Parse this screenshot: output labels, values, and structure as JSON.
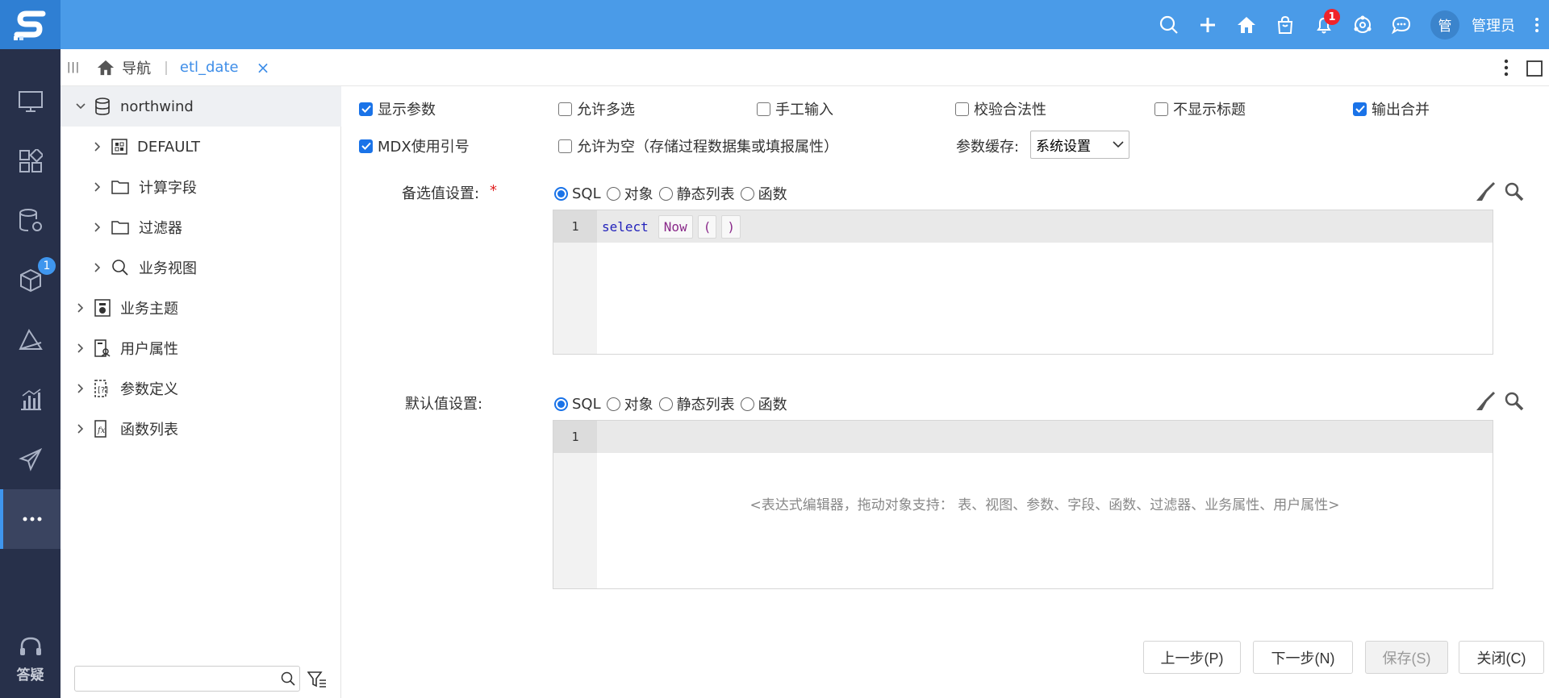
{
  "header": {
    "notifications_count": "1",
    "avatar_text": "管",
    "user_name": "管理员"
  },
  "leftnav": {
    "badge": "1",
    "help_label": "答疑"
  },
  "tabbar": {
    "nav_label": "导航",
    "tab_label": "etl_date",
    "close_glyph": "×"
  },
  "tree": {
    "items": [
      {
        "label": "northwind",
        "level": 0,
        "expanded": true
      },
      {
        "label": "DEFAULT",
        "level": 1
      },
      {
        "label": "计算字段",
        "level": 1
      },
      {
        "label": "过滤器",
        "level": 1
      },
      {
        "label": "业务视图",
        "level": 1
      },
      {
        "label": "业务主题",
        "level": 0
      },
      {
        "label": "用户属性",
        "level": 0
      },
      {
        "label": "参数定义",
        "level": 0
      },
      {
        "label": "函数列表",
        "level": 0
      }
    ],
    "search_placeholder": ""
  },
  "form": {
    "opts": {
      "show_params": {
        "label": "显示参数",
        "checked": true
      },
      "allow_multi": {
        "label": "允许多选",
        "checked": false
      },
      "manual_input": {
        "label": "手工输入",
        "checked": false
      },
      "validate": {
        "label": "校验合法性",
        "checked": false
      },
      "hide_title": {
        "label": "不显示标题",
        "checked": false
      },
      "merge_output": {
        "label": "输出合并",
        "checked": true
      },
      "mdx_quote": {
        "label": "MDX使用引号",
        "checked": true
      },
      "allow_empty": {
        "label": "允许为空（存储过程数据集或填报属性）",
        "checked": false
      }
    },
    "cache_label": "参数缓存:",
    "cache_value": "系统设置",
    "candidate_label": "备选值设置:",
    "required_mark": "*",
    "default_label": "默认值设置:",
    "radio_options": [
      "SQL",
      "对象",
      "静态列表",
      "函数"
    ],
    "candidate_selected": "SQL",
    "default_selected": "SQL",
    "editor1": {
      "line_no": "1",
      "keyword": "select",
      "tokens": [
        "Now",
        "(",
        ")"
      ]
    },
    "editor2": {
      "line_no": "1",
      "placeholder": "<表达式编辑器，拖动对象支持： 表、视图、参数、字段、函数、过滤器、业务属性、用户属性>"
    }
  },
  "buttons": {
    "prev": "上一步(P)",
    "next": "下一步(N)",
    "save": "保存(S)",
    "close": "关闭(C)"
  }
}
